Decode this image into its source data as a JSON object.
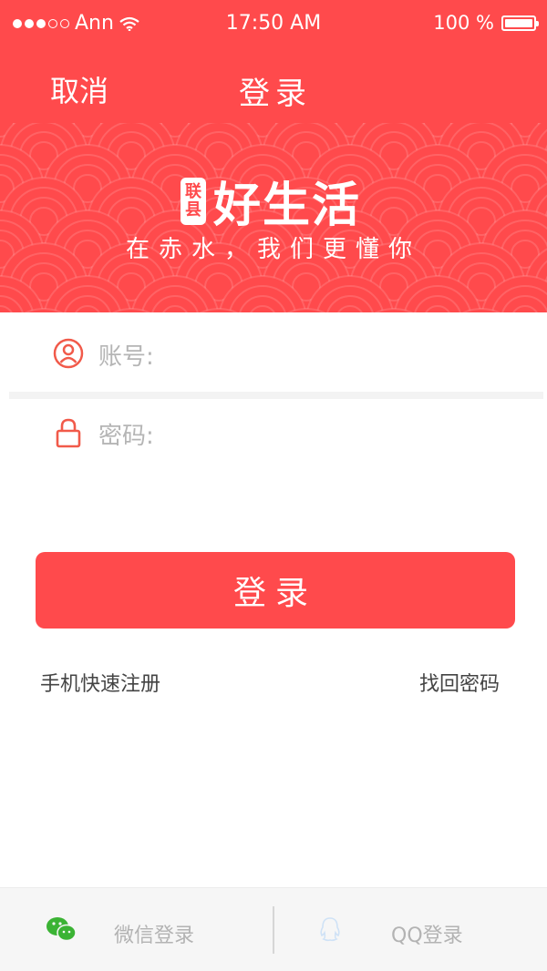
{
  "status_bar": {
    "carrier": "Ann",
    "time": "17:50 AM",
    "battery": "100 %",
    "battery_level": 1.0
  },
  "nav": {
    "cancel_label": "取消",
    "title": "登录"
  },
  "banner": {
    "badge_top": "联",
    "badge_bottom": "县",
    "brand": "好生活",
    "slogan": "在赤水，我们更懂你"
  },
  "form": {
    "account_label": "账号:",
    "account_value": "",
    "password_label": "密码:",
    "password_value": ""
  },
  "login_button": "登录",
  "links": {
    "register": "手机快速注册",
    "forgot": "找回密码"
  },
  "third_party": {
    "wechat": "微信登录",
    "qq": "QQ登录"
  },
  "colors": {
    "accent": "#ff4a4c",
    "wechat_green": "#3bb334",
    "icon_outline": "#f15a4a"
  },
  "icons": {
    "account": "user-icon",
    "password": "lock-icon",
    "wechat": "wechat-icon",
    "qq": "qq-icon"
  }
}
